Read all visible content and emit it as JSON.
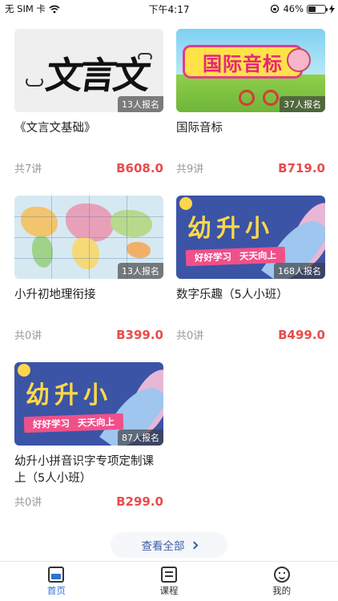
{
  "status_bar": {
    "carrier": "无 SIM 卡",
    "time": "下午4:17",
    "battery": "46%"
  },
  "courses": [
    {
      "title": "《文言文基础》",
      "enrolled": "13人报名",
      "lessons": "共7讲",
      "price": "B608.0",
      "thumb_text": "文言文"
    },
    {
      "title": "国际音标",
      "enrolled": "37人报名",
      "lessons": "共9讲",
      "price": "B719.0",
      "thumb_text": "国际音标"
    },
    {
      "title": "小升初地理衔接",
      "enrolled": "13人报名",
      "lessons": "共0讲",
      "price": "B399.0"
    },
    {
      "title": "数字乐趣（5人小班）",
      "enrolled": "168人报名",
      "lessons": "共0讲",
      "price": "B499.0",
      "thumb_text": "幼升小",
      "thumb_ribbon_1": "好好学习",
      "thumb_ribbon_2": "天天向上"
    },
    {
      "title": "幼升小拼音识字专项定制课 上（5人小班）",
      "enrolled": "87人报名",
      "lessons": "共0讲",
      "price": "B299.0",
      "thumb_text": "幼升小",
      "thumb_ribbon_1": "好好学习",
      "thumb_ribbon_2": "天天向上"
    }
  ],
  "see_all": "查看全部",
  "tabbar": {
    "items": [
      {
        "label": "首页",
        "icon": "home-icon",
        "active": true
      },
      {
        "label": "课程",
        "icon": "book-icon",
        "active": false
      },
      {
        "label": "我的",
        "icon": "smile-icon",
        "active": false
      }
    ]
  },
  "colors": {
    "price": "#e84c4c",
    "active_tab": "#2f74d0",
    "see_all": "#3a5ea8"
  }
}
